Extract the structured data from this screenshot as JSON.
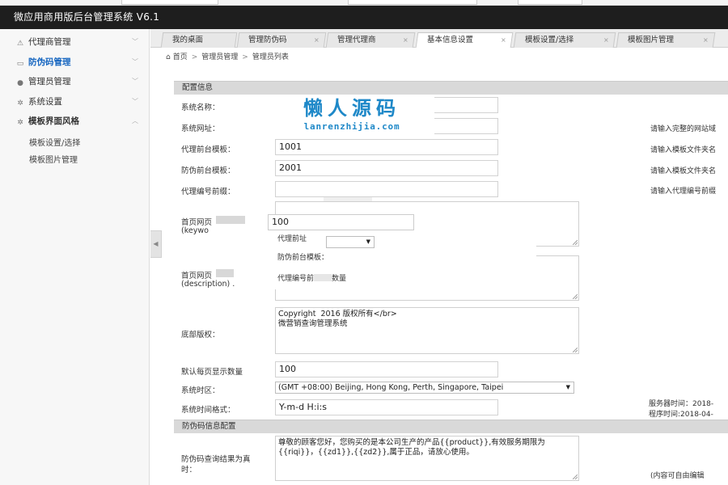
{
  "app": {
    "title": "微应用商用版后台管理系统 V6.1"
  },
  "sidebar": {
    "items": [
      {
        "label": "代理商管理",
        "icon": "agent-icon",
        "chevron": "﹀"
      },
      {
        "label": "防伪码管理",
        "icon": "card-icon",
        "chevron": "﹀"
      },
      {
        "label": "管理员管理",
        "icon": "user-icon",
        "chevron": "﹀"
      },
      {
        "label": "系统设置",
        "icon": "gear-icon",
        "chevron": "﹀"
      },
      {
        "label": "模板界面风格",
        "icon": "gear-icon",
        "chevron": "︿"
      }
    ],
    "subitems": [
      "模板设置/选择",
      "模板图片管理"
    ],
    "active_index": 1
  },
  "tabs": [
    {
      "label": "我的桌面",
      "close": ""
    },
    {
      "label": "管理防伪码",
      "close": "×"
    },
    {
      "label": "管理代理商",
      "close": "×"
    },
    {
      "label": "基本信息设置",
      "close": "×"
    },
    {
      "label": "模板设置/选择",
      "close": "×"
    },
    {
      "label": "模板图片管理",
      "close": "×"
    }
  ],
  "breadcrumb": {
    "home": "首页",
    "sep": ">",
    "items": [
      "管理员管理",
      "管理员列表"
    ]
  },
  "sections": {
    "config": "配置信息",
    "fwm": "防伪码信息配置"
  },
  "form": {
    "site_name_label": "系统名称：",
    "site_url_label": "系统网址：",
    "site_url_hint": "请输入完整的网站域",
    "agent_tpl_label": "代理前台模板：",
    "agent_tpl_value": "1001",
    "agent_tpl_hint": "请输入模板文件夹名",
    "fwm_tpl_label": "防伪前台模板：",
    "fwm_tpl_value": "2001",
    "fwm_tpl_hint": "请输入模板文件夹名",
    "agent_prefix_label": "代理编号前缀：",
    "agent_prefix_hint": "请输入代理编号前缀",
    "keywords_label": "首页网页",
    "keywords_label2": "(keywo",
    "keywords_value": "100",
    "description_label": "首页网页",
    "description_label2": "(description) .",
    "copyright_label": "底部版权：",
    "copyright_value": "Copyright  2016 版权所有</br>\n微营销查询管理系统",
    "pagesize_label": "默认每页显示数量",
    "pagesize_value": "100",
    "timezone_label": "系统时区：",
    "timezone_value": "(GMT +08:00) Beijing, Hong Kong, Perth, Singapore, Taipei",
    "timefmt_label": "系统时间格式：",
    "timefmt_value": "Y-m-d H:i:s",
    "server_time": "服务器时间：2018-",
    "program_time": "程序时间:2018-04-",
    "query_label": "防伪码查询结果为真",
    "query_label2": "时：",
    "query_value": "尊敬的顾客您好，您购买的是本公司生产的产品{{product}},有效服务期限为{{riqi}}，{{zd1}},{{zd2}},属于正品，请放心使用。",
    "query_hint": "(内容可自由编辑"
  },
  "popup": {
    "line1": "代理前址",
    "line2": "防伪前台模板：",
    "line3": "代理编号前",
    "line3b": "数量",
    "select_arrow": "▼"
  },
  "watermark": {
    "line1": "懒人源码",
    "line2": "lanrenzhijia.com"
  },
  "handle_arrow": "◀",
  "colors": {
    "titlebar": "#1e1e1e",
    "accent": "#1565c0",
    "watermark": "#1e88c8",
    "section_bg": "#d9d9d9"
  }
}
